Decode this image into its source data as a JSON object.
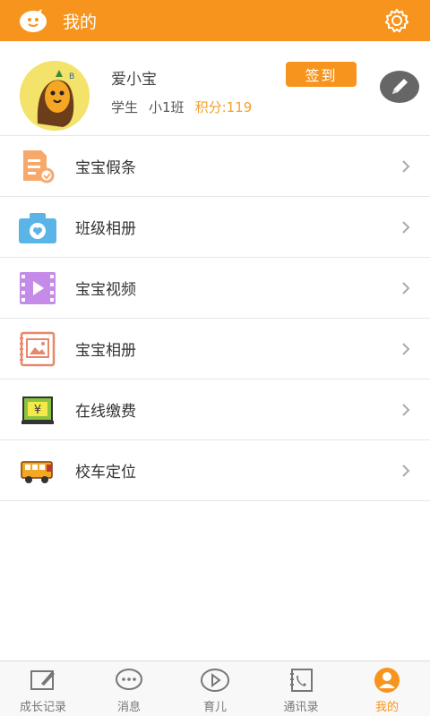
{
  "header": {
    "title": "我的"
  },
  "profile": {
    "name": "爱小宝",
    "role": "学生",
    "class_name": "小1班",
    "points_text": "积分:119",
    "checkin_label": "签到"
  },
  "menu": [
    {
      "label": "宝宝假条",
      "icon": "leave-note-icon"
    },
    {
      "label": "班级相册",
      "icon": "camera-icon"
    },
    {
      "label": "宝宝视频",
      "icon": "video-icon"
    },
    {
      "label": "宝宝相册",
      "icon": "photo-album-icon"
    },
    {
      "label": "在线缴费",
      "icon": "payment-icon"
    },
    {
      "label": "校车定位",
      "icon": "school-bus-icon"
    }
  ],
  "tabs": [
    {
      "label": "成长记录",
      "icon": "growth-record-icon"
    },
    {
      "label": "消息",
      "icon": "message-icon"
    },
    {
      "label": "育儿",
      "icon": "parenting-icon"
    },
    {
      "label": "通讯录",
      "icon": "contacts-icon"
    },
    {
      "label": "我的",
      "icon": "profile-icon",
      "active": true
    }
  ],
  "colors": {
    "accent": "#f7941d",
    "points": "#f3a02a"
  }
}
